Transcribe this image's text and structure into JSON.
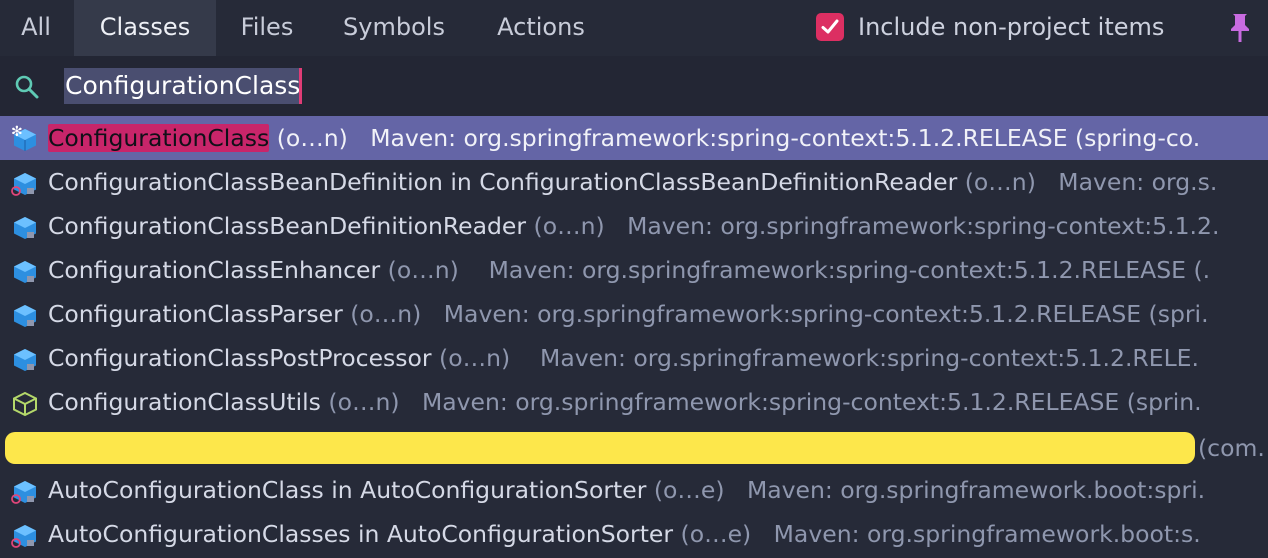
{
  "tabs": [
    {
      "label": "All",
      "active": false
    },
    {
      "label": "Classes",
      "active": true
    },
    {
      "label": "Files",
      "active": false
    },
    {
      "label": "Symbols",
      "active": false
    },
    {
      "label": "Actions",
      "active": false
    }
  ],
  "include_non_project": {
    "label": "Include non-project items",
    "checked": true,
    "accent_color": "#dc2f62"
  },
  "pin_icon": "pin-icon",
  "search": {
    "icon": "search-icon",
    "value": "ConfigurationClass"
  },
  "results": [
    {
      "highlight": "ConfigurationClass",
      "name": "",
      "context": "",
      "suffix": "(o…n)",
      "location": "Maven: org.springframework:spring-context:5.1.2.RELEASE (spring-co.",
      "icon": "annotation-class-icon",
      "selected": true
    },
    {
      "highlight": "",
      "name": "ConfigurationClassBeanDefinition",
      "context": " in ConfigurationClassBeanDefinitionReader",
      "suffix": "(o…n)",
      "location": "Maven: org.s.",
      "icon": "private-class-icon",
      "selected": false
    },
    {
      "highlight": "",
      "name": "ConfigurationClassBeanDefinitionReader",
      "context": "",
      "suffix": "(o…n)",
      "location": "Maven: org.springframework:spring-context:5.1.2.",
      "icon": "class-icon",
      "selected": false
    },
    {
      "highlight": "",
      "name": "ConfigurationClassEnhancer",
      "context": "",
      "suffix": "(o…n)",
      "location": "Maven: org.springframework:spring-context:5.1.2.RELEASE (.",
      "icon": "class-icon",
      "selected": false
    },
    {
      "highlight": "",
      "name": "ConfigurationClassParser",
      "context": "",
      "suffix": "(o…n)",
      "location": "Maven: org.springframework:spring-context:5.1.2.RELEASE (spri.",
      "icon": "class-icon",
      "selected": false
    },
    {
      "highlight": "",
      "name": "ConfigurationClassPostProcessor",
      "context": "",
      "suffix": "(o…n)",
      "location": "Maven: org.springframework:spring-context:5.1.2.RELE.",
      "icon": "class-icon",
      "selected": false
    },
    {
      "highlight": "",
      "name": "ConfigurationClassUtils",
      "context": "",
      "suffix": "(o…n)",
      "location": "Maven: org.springframework:spring-context:5.1.2.RELEASE (sprin.",
      "icon": "final-class-icon",
      "selected": false
    },
    {
      "highlight": "",
      "name": "AutoConfigurationClass",
      "context": " in AutoConfigurationSorter",
      "suffix": "(o…e)",
      "location": "Maven: org.springframework.boot:spri.",
      "icon": "private-class-icon",
      "selected": false
    },
    {
      "highlight": "",
      "name": "AutoConfigurationClasses",
      "context": " in AutoConfigurationSorter",
      "suffix": "(o…e)",
      "location": "Maven: org.springframework.boot:s.",
      "icon": "private-class-icon",
      "selected": false
    }
  ],
  "redacted_row": {
    "tail": "(com.",
    "color": "#fde74b"
  },
  "colors": {
    "selection": "#6465a6",
    "match_highlight": "#c8256a",
    "background": "#262a38"
  }
}
